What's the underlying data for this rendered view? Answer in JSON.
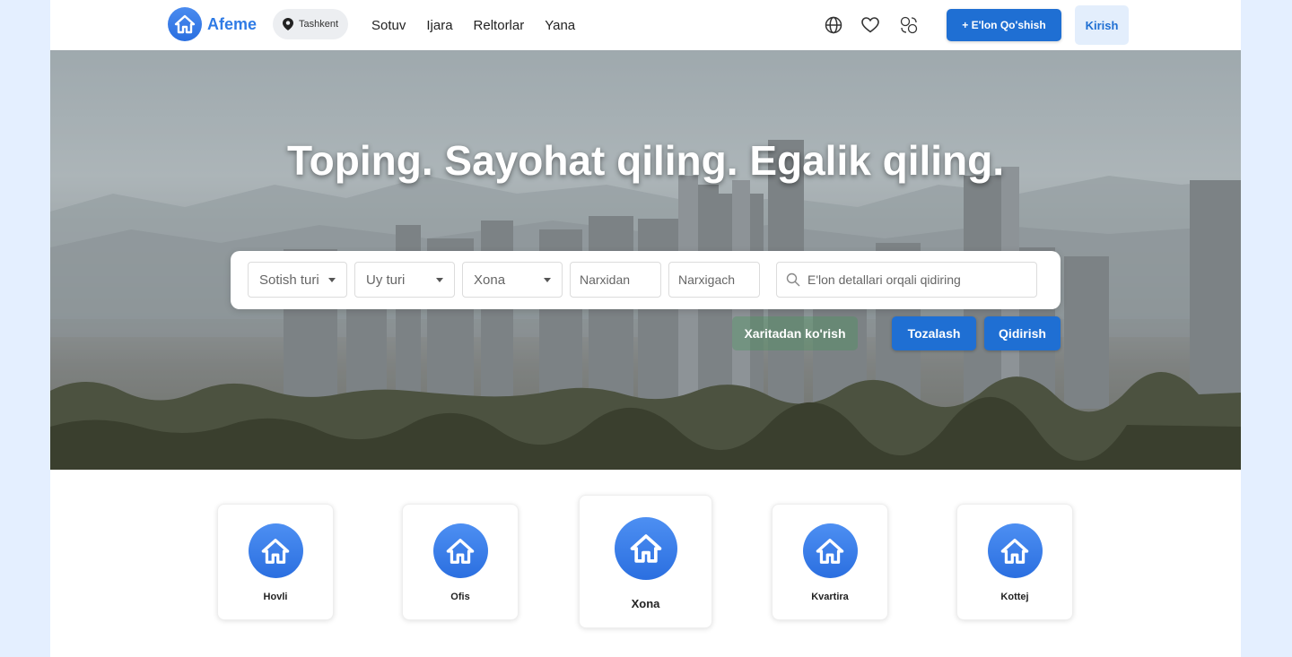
{
  "header": {
    "logo_text": "Afeme",
    "city": "Tashkent",
    "nav": [
      "Sotuv",
      "Ijara",
      "Reltorlar",
      "Yana"
    ],
    "icons": [
      "globe-icon",
      "heart-icon",
      "currency-exchange-icon"
    ],
    "add_button": "+ E'lon Qo'shish",
    "login_button": "Kirish"
  },
  "hero": {
    "title": "Toping. Sayohat qiling. Egalik qiling."
  },
  "search": {
    "sale_type": "Sotish turi",
    "house_type": "Uy turi",
    "rooms": "Xona",
    "price_from": "Narxidan",
    "price_to": "Narxigach",
    "query_placeholder": "E'lon detallari orqali qidiring",
    "map_button": "Xaritadan ko'rish",
    "clear_button": "Tozalash",
    "search_button": "Qidirish"
  },
  "categories": [
    {
      "label": "Hovli"
    },
    {
      "label": "Ofis"
    },
    {
      "label": "Xona"
    },
    {
      "label": "Kvartira"
    },
    {
      "label": "Kottej"
    }
  ],
  "colors": {
    "primary": "#1f6fd3",
    "accent": "#2f7be5",
    "page_bg": "#e4efff"
  }
}
